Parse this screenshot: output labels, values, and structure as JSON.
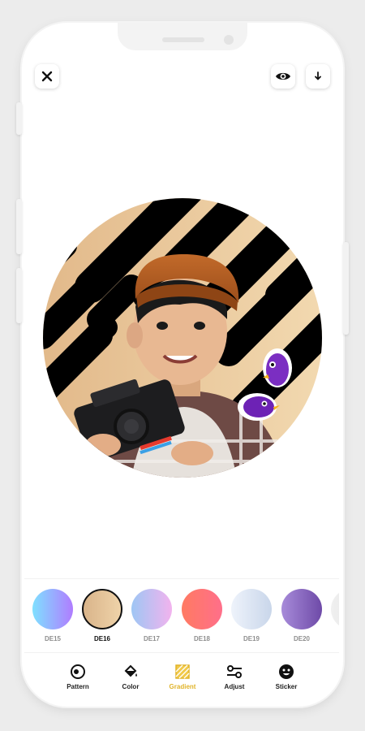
{
  "app": {
    "close_icon": "close-icon",
    "preview_icon": "eye-icon",
    "download_icon": "download-icon"
  },
  "colors": {
    "accent": "#e1b42a",
    "selected_border": "#111111",
    "portrait_gradient": [
      "#e2b98a",
      "#f2d9b0"
    ],
    "pattern": "#000000"
  },
  "swatches": [
    {
      "label": "DE15",
      "from": "#7fe0ff",
      "to": "#b07cff",
      "selected": false
    },
    {
      "label": "DE16",
      "from": "#d9b48a",
      "to": "#efd3a9",
      "selected": true
    },
    {
      "label": "DE17",
      "from": "#9ec6f4",
      "to": "#f2b3ee",
      "selected": false
    },
    {
      "label": "DE18",
      "from": "#ff7a62",
      "to": "#ff6f8a",
      "selected": false
    },
    {
      "label": "DE19",
      "from": "#eef3fb",
      "to": "#c9d6ea",
      "selected": false
    },
    {
      "label": "DE20",
      "from": "#a78bd9",
      "to": "#6e4aa8",
      "selected": false
    },
    {
      "label": "",
      "from": "#f0f0f0",
      "to": "#e0e0e0",
      "selected": false
    }
  ],
  "toolbar": {
    "items": [
      {
        "label": "Pattern",
        "icon": "pattern-icon"
      },
      {
        "label": "Color",
        "icon": "paint-bucket-icon"
      },
      {
        "label": "Gradient",
        "icon": "gradient-icon",
        "active": true
      },
      {
        "label": "Adjust",
        "icon": "sliders-icon"
      },
      {
        "label": "Sticker",
        "icon": "smiley-icon"
      }
    ]
  }
}
